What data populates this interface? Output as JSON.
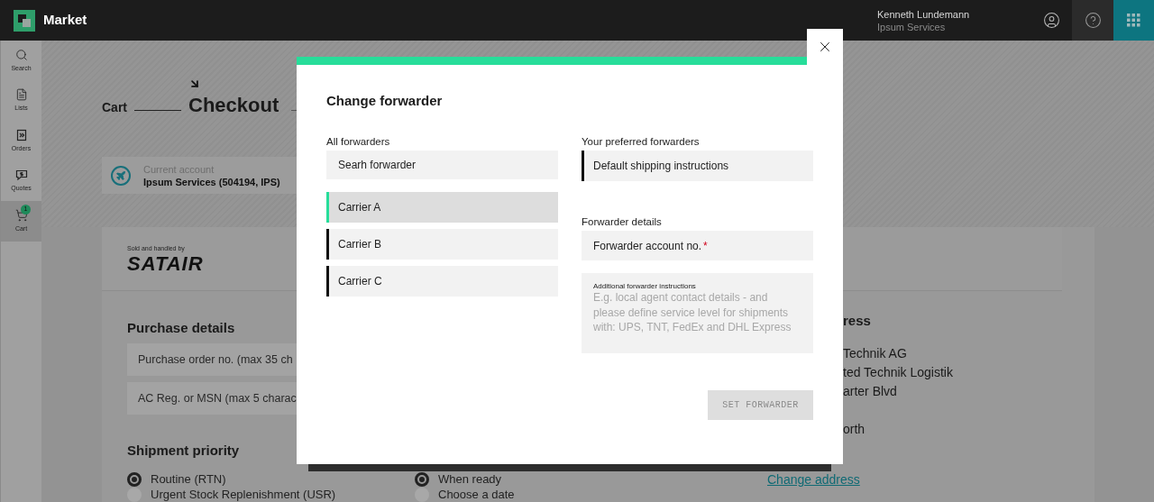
{
  "header": {
    "app_name": "Market",
    "user_name": "Kenneth Lundemann",
    "company": "Ipsum Services"
  },
  "sidebar": {
    "items": [
      {
        "label": "Search",
        "selected": false
      },
      {
        "label": "Lists",
        "selected": false
      },
      {
        "label": "Orders",
        "selected": false
      },
      {
        "label": "Quotes",
        "selected": false
      },
      {
        "label": "Cart",
        "selected": true,
        "badge": "1"
      }
    ]
  },
  "stepper": {
    "steps": [
      {
        "label": "Cart",
        "selected": false
      },
      {
        "label": "Checkout",
        "selected": true
      }
    ]
  },
  "account": {
    "label": "Current account",
    "value": "Ipsum Services (504194, IPS)"
  },
  "seller": {
    "caption": "Sold and handled by",
    "brand": "SATAIR"
  },
  "purchase_details": {
    "title": "Purchase details",
    "fields": [
      {
        "placeholder": "Purchase order no. (max 35 ch"
      },
      {
        "placeholder": "AC Reg. or MSN (max 5 charac"
      }
    ]
  },
  "shipment_priority": {
    "title": "Shipment priority",
    "options": [
      {
        "label": "Routine (RTN)",
        "selected": true
      },
      {
        "label": "Urgent Stock Replenishment (USR)",
        "selected": false
      }
    ],
    "timing_options": [
      {
        "label": "When ready",
        "selected": true
      },
      {
        "label": "Choose a date",
        "selected": false
      }
    ]
  },
  "address": {
    "title": "ress",
    "lines": [
      "Technik AG",
      "ted Technik Logistik",
      "arter Blvd"
    ],
    "city": "orth",
    "link": "Change address"
  },
  "modal": {
    "title": "Change forwarder",
    "all_forwarders": {
      "label": "All forwarders",
      "search_placeholder": "Searh forwarder",
      "items": [
        {
          "label": "Carrier A",
          "selected": true
        },
        {
          "label": "Carrier B",
          "selected": false
        },
        {
          "label": "Carrier C",
          "selected": false
        }
      ]
    },
    "preferred": {
      "label": "Your preferred forwarders",
      "items": [
        {
          "label": "Default shipping instructions"
        }
      ]
    },
    "details": {
      "label": "Forwarder details",
      "account_placeholder": "Forwarder account no.",
      "required_mark": "*",
      "instructions_label": "Additional forwarder instructions",
      "instructions_placeholder": "E.g. local agent contact details - and please define service level for shipments with: UPS, TNT, FedEx and DHL Express"
    },
    "submit": {
      "label": "SET FORWARDER",
      "disabled": true
    }
  }
}
